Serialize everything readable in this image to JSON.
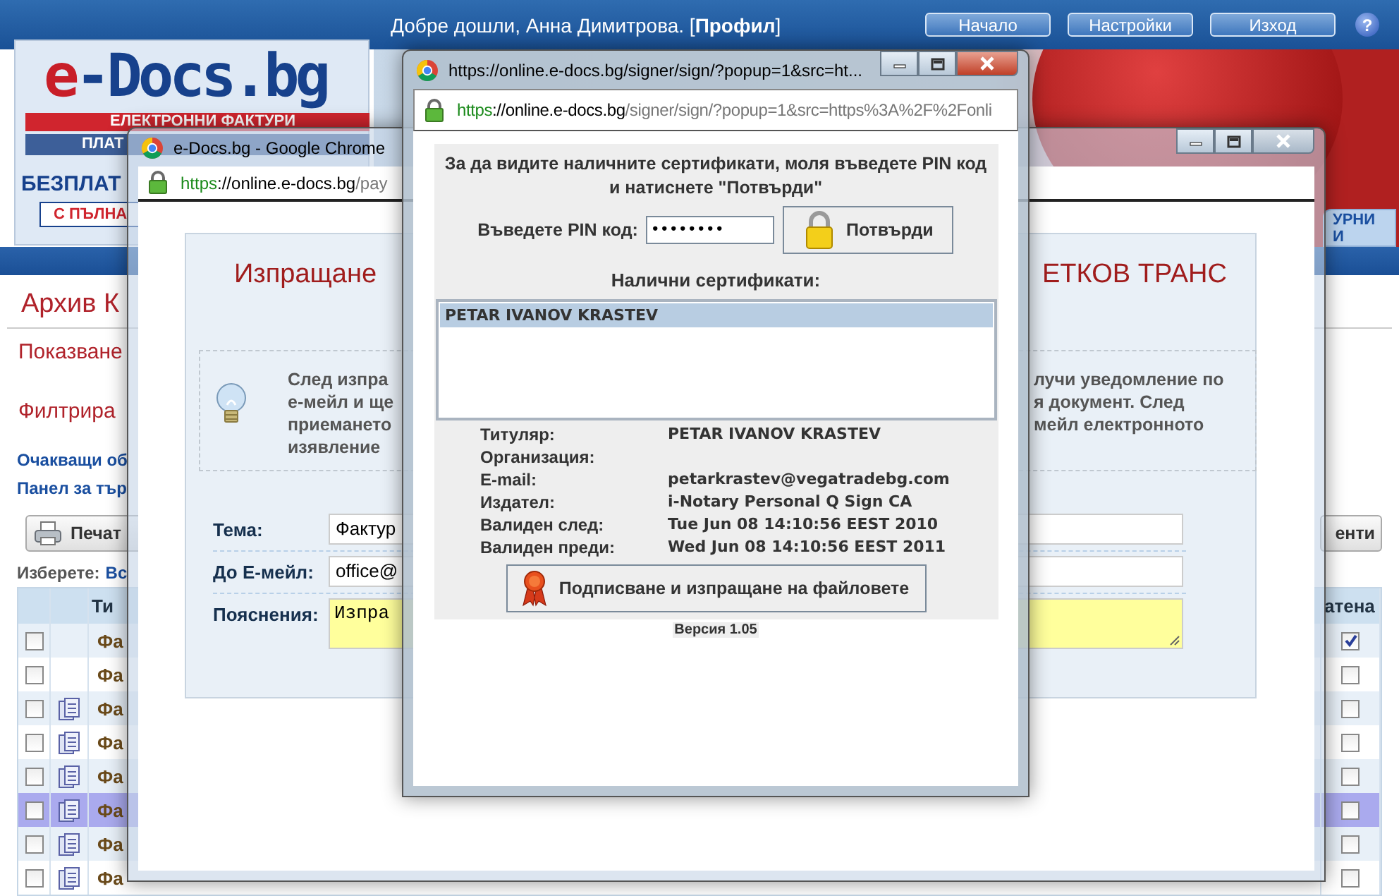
{
  "header": {
    "welcome": "Добре дошли, Анна Димитрова. [**Профил**]",
    "buttons": [
      "Начало",
      "Настройки",
      "Изход"
    ],
    "help": "?"
  },
  "logo": {
    "mark": "e",
    "name": "-Docs.bg",
    "band_red": "ЕЛЕКТРОННИ ФАКТУРИ",
    "band_blue": "ПЛАТ",
    "tagline": "БЕЗПЛАТ",
    "button": "С ПЪЛНА"
  },
  "nav_tab": {
    "lines": [
      "УРНИ",
      "И"
    ]
  },
  "page": {
    "title": "Архив К",
    "sections": [
      "Показване",
      "Филтрира"
    ],
    "links": [
      "Очакващи об",
      "Панел за тър"
    ],
    "print_button": "Печат",
    "right_button": "енти",
    "select_label": "Изберете:",
    "select_link": "Вс",
    "table": {
      "columns": [
        "Ти",
        "атена"
      ],
      "rows": [
        {
          "kind": "plain",
          "checked": false,
          "cell": "Фа",
          "mark_checked": true,
          "selected": false
        },
        {
          "kind": "plain",
          "checked": false,
          "cell": "Фа",
          "mark_checked": false,
          "selected": false
        },
        {
          "kind": "file",
          "checked": false,
          "cell": "Фа",
          "mark_checked": false,
          "selected": false
        },
        {
          "kind": "file",
          "checked": false,
          "cell": "Фа",
          "mark_checked": false,
          "selected": false
        },
        {
          "kind": "file",
          "checked": false,
          "cell": "Фа",
          "mark_checked": false,
          "selected": false
        },
        {
          "kind": "file",
          "checked": false,
          "cell": "Фа",
          "mark_checked": false,
          "selected": true
        },
        {
          "kind": "file",
          "checked": false,
          "cell": "Фа",
          "mark_checked": false,
          "selected": false
        },
        {
          "kind": "file",
          "checked": false,
          "cell": "Фа",
          "mark_checked": false,
          "selected": false
        }
      ]
    }
  },
  "send_window": {
    "title": "e-Docs.bg - Google Chrome",
    "active": false,
    "url": {
      "scheme": "https",
      "host": "://online.e-docs.bg",
      "path": "/pay"
    },
    "heading": [
      "Изпращане",
      "ЕТКОВ ТРАНС"
    ],
    "notice_left": [
      "След изпра",
      "е-мейл и ще",
      "приемането",
      "изявление"
    ],
    "notice_right": [
      "лучи уведомление по",
      "я документ. След",
      "мейл електронното"
    ],
    "fields": [
      {
        "kind": "input",
        "label": "Тема:",
        "value": "Фактур"
      },
      {
        "kind": "input",
        "label": "До Е-мейл:",
        "value": "office@"
      },
      {
        "kind": "textarea",
        "label": "Пояснения:",
        "value": "Изпра"
      }
    ]
  },
  "signer_window": {
    "title": "https://online.e-docs.bg/signer/sign/?popup=1&src=ht...",
    "active": true,
    "url": {
      "scheme": "https",
      "host": "://online.e-docs.bg",
      "path": "/signer/sign/?popup=1&src=https%3A%2F%2Fonli"
    },
    "instruction": "За да видите наличните сертификати, моля въведете PIN код и натиснете \"Потвърди\"",
    "pin_label": "Въведете PIN код:",
    "pin_value": "••••••••",
    "confirm_button": "Потвърди",
    "list_title": "Налични сертификати:",
    "certificates": [
      {
        "name": "PETAR IVANOV KRASTEV",
        "selected": true
      }
    ],
    "details": [
      {
        "label": "Титуляр:",
        "value": "PETAR IVANOV KRASTEV"
      },
      {
        "label": "Организация:"
      },
      {
        "label": "E-mail:",
        "value": "petarkrastev@vegatradebg.com"
      },
      {
        "label": "Издател:",
        "value": "i-Notary Personal Q Sign CA"
      },
      {
        "label": "Валиден след:",
        "value": "Tue Jun 08 14:10:56 EEST 2010"
      },
      {
        "label": "Валиден преди:",
        "value": "Wed Jun 08 14:10:56 EEST 2011"
      }
    ],
    "sign_button": "Подписване и изпращане на файловете",
    "version": "Версия 1.05"
  }
}
